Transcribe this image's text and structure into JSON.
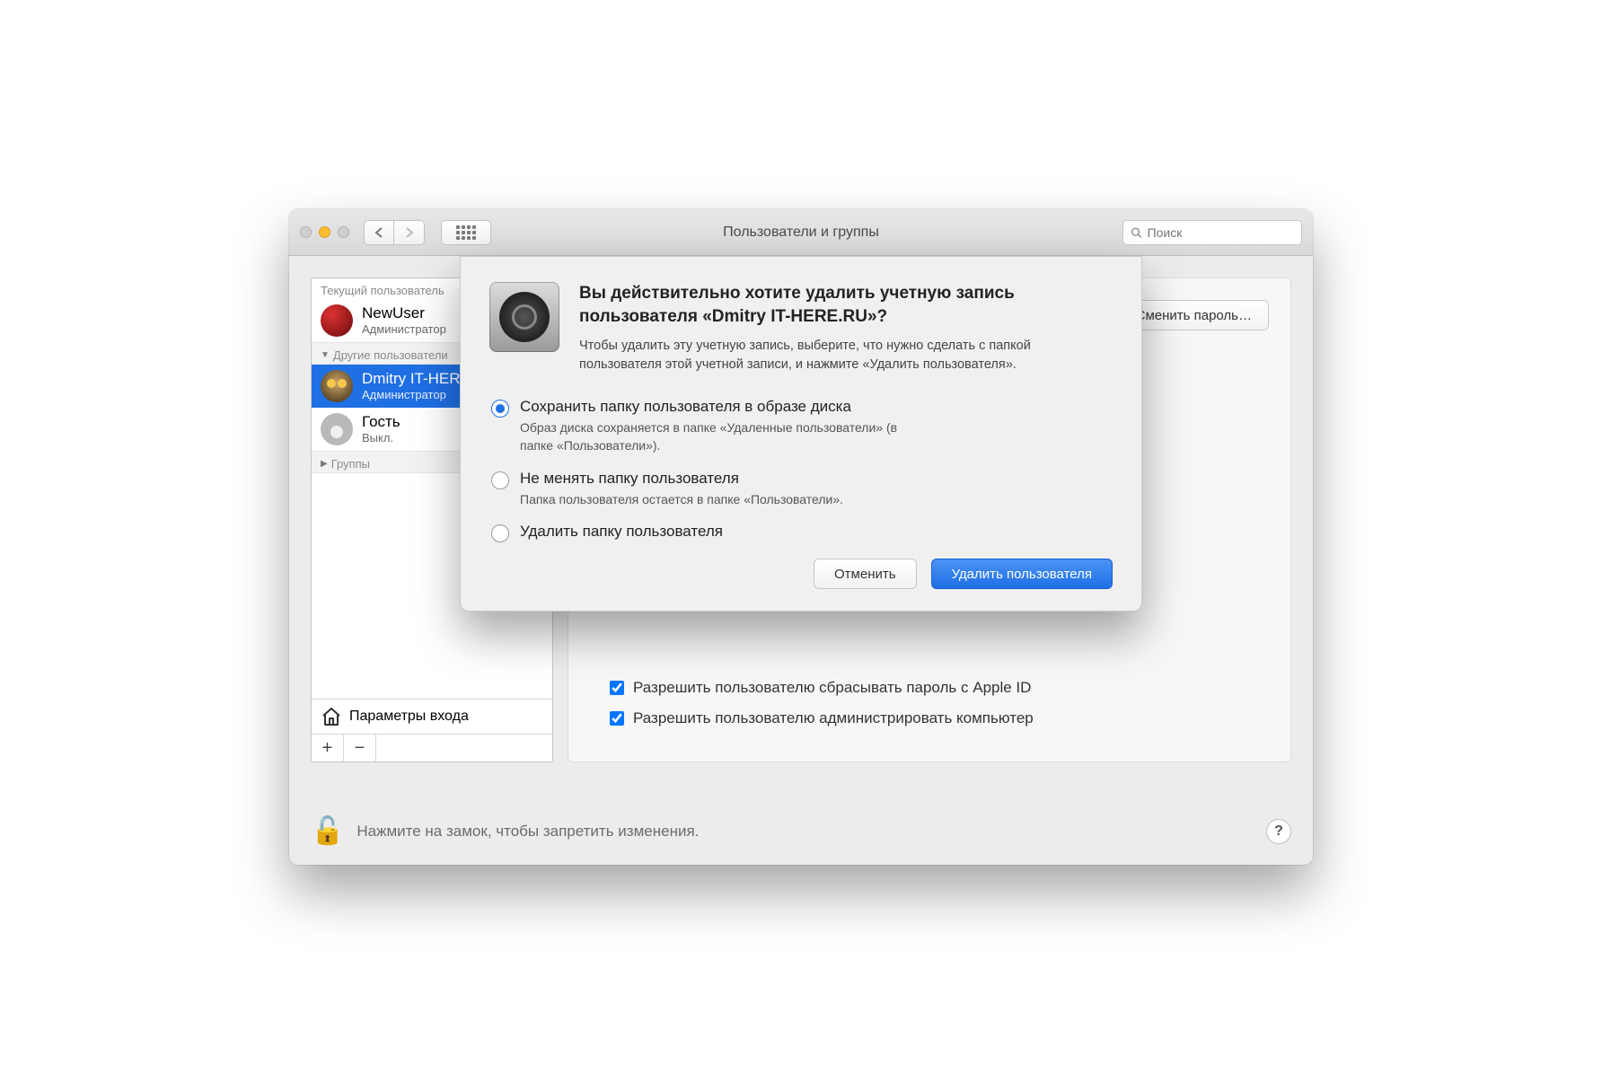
{
  "window": {
    "title": "Пользователи и группы",
    "search_placeholder": "Поиск"
  },
  "sidebar": {
    "current_label": "Текущий пользователь",
    "others_label": "Другие пользователи",
    "groups_label": "Группы",
    "login_options_label": "Параметры входа",
    "users": [
      {
        "name": "NewUser",
        "role": "Администратор",
        "avatar": "rose",
        "selected": false
      },
      {
        "name": "Dmitry IT-HERE.RU",
        "role": "Администратор",
        "avatar": "owl",
        "selected": true
      },
      {
        "name": "Гость",
        "role": "Выкл.",
        "avatar": "guest",
        "selected": false
      }
    ]
  },
  "main": {
    "change_password_label": "Сменить пароль…",
    "checkbox_reset_appleid": "Разрешить пользователю сбрасывать пароль с Apple ID",
    "checkbox_admin": "Разрешить пользователю администрировать компьютер"
  },
  "lock": {
    "text": "Нажмите на замок, чтобы запретить изменения."
  },
  "modal": {
    "title": "Вы действительно хотите удалить учетную запись пользователя «Dmitry IT-HERE.RU»?",
    "description": "Чтобы удалить эту учетную запись, выберите, что нужно сделать с папкой пользователя этой учетной записи, и нажмите «Удалить пользователя».",
    "options": [
      {
        "label": "Сохранить папку пользователя в образе диска",
        "desc": "Образ диска сохраняется в папке «Удаленные пользователи» (в папке «Пользователи»).",
        "selected": true
      },
      {
        "label": "Не менять папку пользователя",
        "desc": "Папка пользователя остается в папке «Пользователи».",
        "selected": false
      },
      {
        "label": "Удалить папку пользователя",
        "desc": "",
        "selected": false
      }
    ],
    "cancel_label": "Отменить",
    "confirm_label": "Удалить пользователя"
  }
}
